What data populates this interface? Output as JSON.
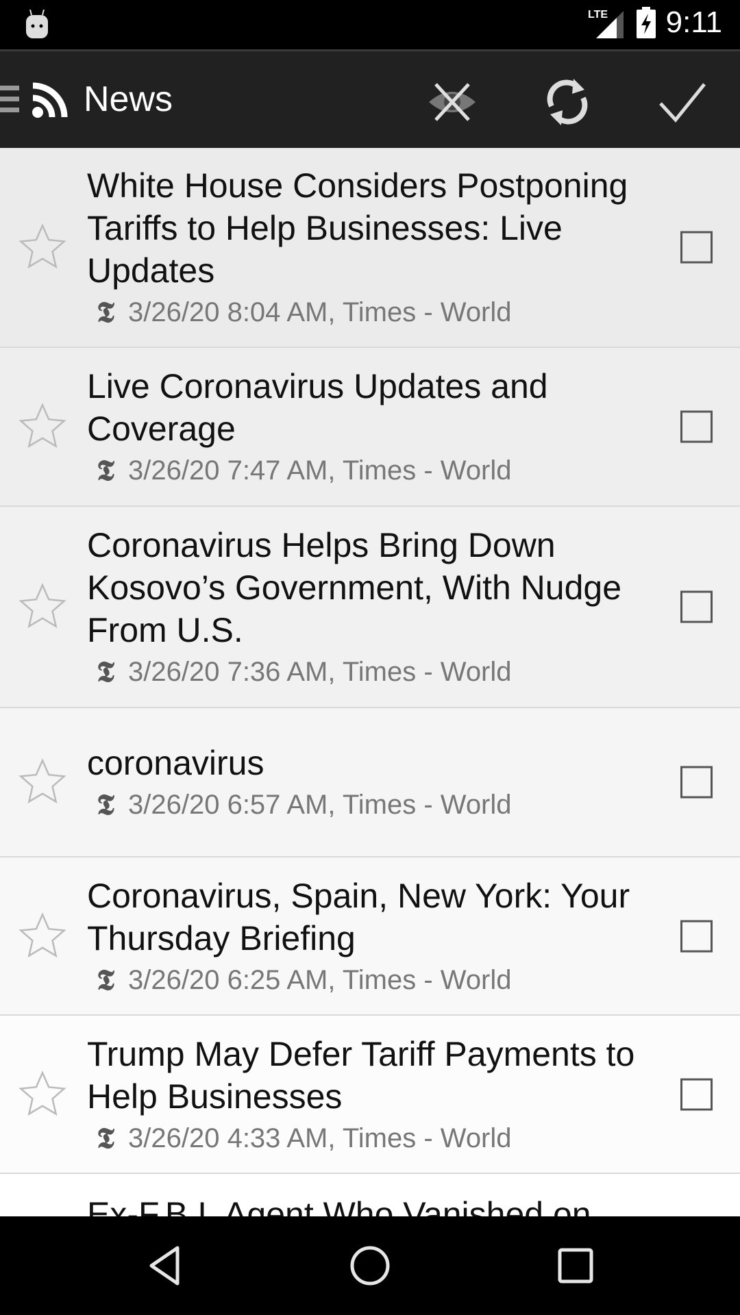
{
  "status_bar": {
    "time": "9:11",
    "network": "LTE",
    "icons": [
      "android-notification-icon",
      "lte-signal-icon",
      "battery-charging-icon"
    ]
  },
  "toolbar": {
    "title": "News",
    "icons": [
      "menu-icon",
      "rss-icon",
      "hide-read-icon",
      "refresh-icon",
      "mark-all-read-icon"
    ]
  },
  "articles": [
    {
      "title": "White House Considers Postponing Tariffs to Help Businesses: Live Updates",
      "meta": "3/26/20 8:04 AM, Times - World",
      "starred": false,
      "checked": false
    },
    {
      "title": "Live Coronavirus Updates and Coverage",
      "meta": "3/26/20 7:47 AM, Times - World",
      "starred": false,
      "checked": false
    },
    {
      "title": "Coronavirus Helps Bring Down Kosovo’s Government, With Nudge From U.S.",
      "meta": "3/26/20 7:36 AM, Times - World",
      "starred": false,
      "checked": false
    },
    {
      "title": "coronavirus",
      "meta": "3/26/20 6:57 AM, Times - World",
      "starred": false,
      "checked": false
    },
    {
      "title": "Coronavirus, Spain, New York: Your Thursday Briefing",
      "meta": "3/26/20 6:25 AM, Times - World",
      "starred": false,
      "checked": false
    },
    {
      "title": "Trump May Defer Tariff Payments to Help Businesses",
      "meta": "3/26/20 4:33 AM, Times - World",
      "starred": false,
      "checked": false
    },
    {
      "title": "Ex-F.B.I. Agent Who Vanished on"
    }
  ],
  "feed_icon_glyph": "𝕿",
  "nav_bar": {
    "icons": [
      "back-icon",
      "home-icon",
      "recents-icon"
    ]
  }
}
